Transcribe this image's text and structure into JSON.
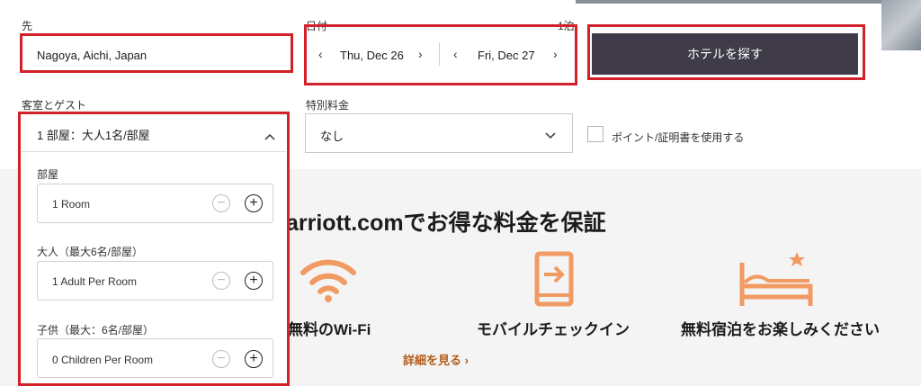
{
  "search": {
    "destination_label": "先",
    "destination_value": "Nagoya, Aichi, Japan",
    "dates_label": "日付",
    "nights_label": "1泊",
    "checkin": "Thu, Dec 26",
    "checkout": "Fri, Dec 27",
    "find_button": "ホテルを探す"
  },
  "rooms_guests": {
    "label": "客室とゲスト",
    "summary": "1 部屋：大人1名/部屋",
    "rooms_label": "部屋",
    "rooms_value": "1 Room",
    "adults_label": "大人（最大6名/部屋）",
    "adults_value": "1 Adult Per Room",
    "children_label": "子供（最大：6名/部屋）",
    "children_value": "0 Children Per Room"
  },
  "special_rates": {
    "label": "特別料金",
    "value": "なし"
  },
  "points": {
    "label": "ポイント/証明書を使用する"
  },
  "promo": {
    "heading": "arriott.comでお得な料金を保証",
    "features": [
      {
        "label": "無料のWi-Fi",
        "icon": "wifi-icon"
      },
      {
        "label": "モバイルチェックイン",
        "icon": "mobile-checkin-icon"
      },
      {
        "label": "無料宿泊をお楽しみください",
        "icon": "bed-star-icon"
      }
    ],
    "details_link": "詳細を見る ›"
  },
  "colors": {
    "accent_orange": "#f29a63",
    "button_dark": "#3f3b48",
    "annotation_red": "#d3212a",
    "link_brown": "#b25c1c"
  }
}
